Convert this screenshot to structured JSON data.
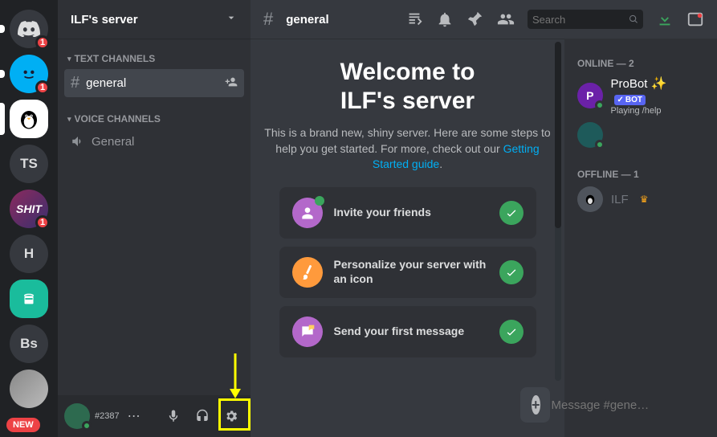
{
  "rail": {
    "home_badge": "1",
    "items": [
      {
        "kind": "blue",
        "badge": "1"
      },
      {
        "kind": "white"
      },
      {
        "kind": "text",
        "label": "TS"
      },
      {
        "kind": "shit",
        "label": "SHIT",
        "badge": "1"
      },
      {
        "kind": "text",
        "label": "H"
      },
      {
        "kind": "teal"
      },
      {
        "kind": "text",
        "label": "Bs"
      },
      {
        "kind": "gray"
      }
    ],
    "new_label": "NEW"
  },
  "server": {
    "name": "ILF's server"
  },
  "categories": {
    "text_label": "TEXT CHANNELS",
    "voice_label": "VOICE CHANNELS"
  },
  "channels": {
    "general": "general",
    "voice_general": "General"
  },
  "user": {
    "tag": "#2387"
  },
  "topbar": {
    "channel": "general",
    "search_placeholder": "Search"
  },
  "welcome": {
    "line1": "Welcome to",
    "line2": "ILF's server",
    "body_a": "This is a brand new, shiny server. Here are some steps to help you get started. For more, check out our ",
    "link": "Getting Started guide",
    "body_b": "."
  },
  "cards": {
    "invite": "Invite your friends",
    "personalize": "Personalize your server with an icon",
    "send": "Send your first message"
  },
  "composer": {
    "placeholder": "Message #gene…"
  },
  "members": {
    "online_label": "ONLINE — 2",
    "offline_label": "OFFLINE — 1",
    "probot": "ProBot",
    "probot_status": "Playing /help",
    "bot_tag": "BOT",
    "ilf": "ILF"
  }
}
